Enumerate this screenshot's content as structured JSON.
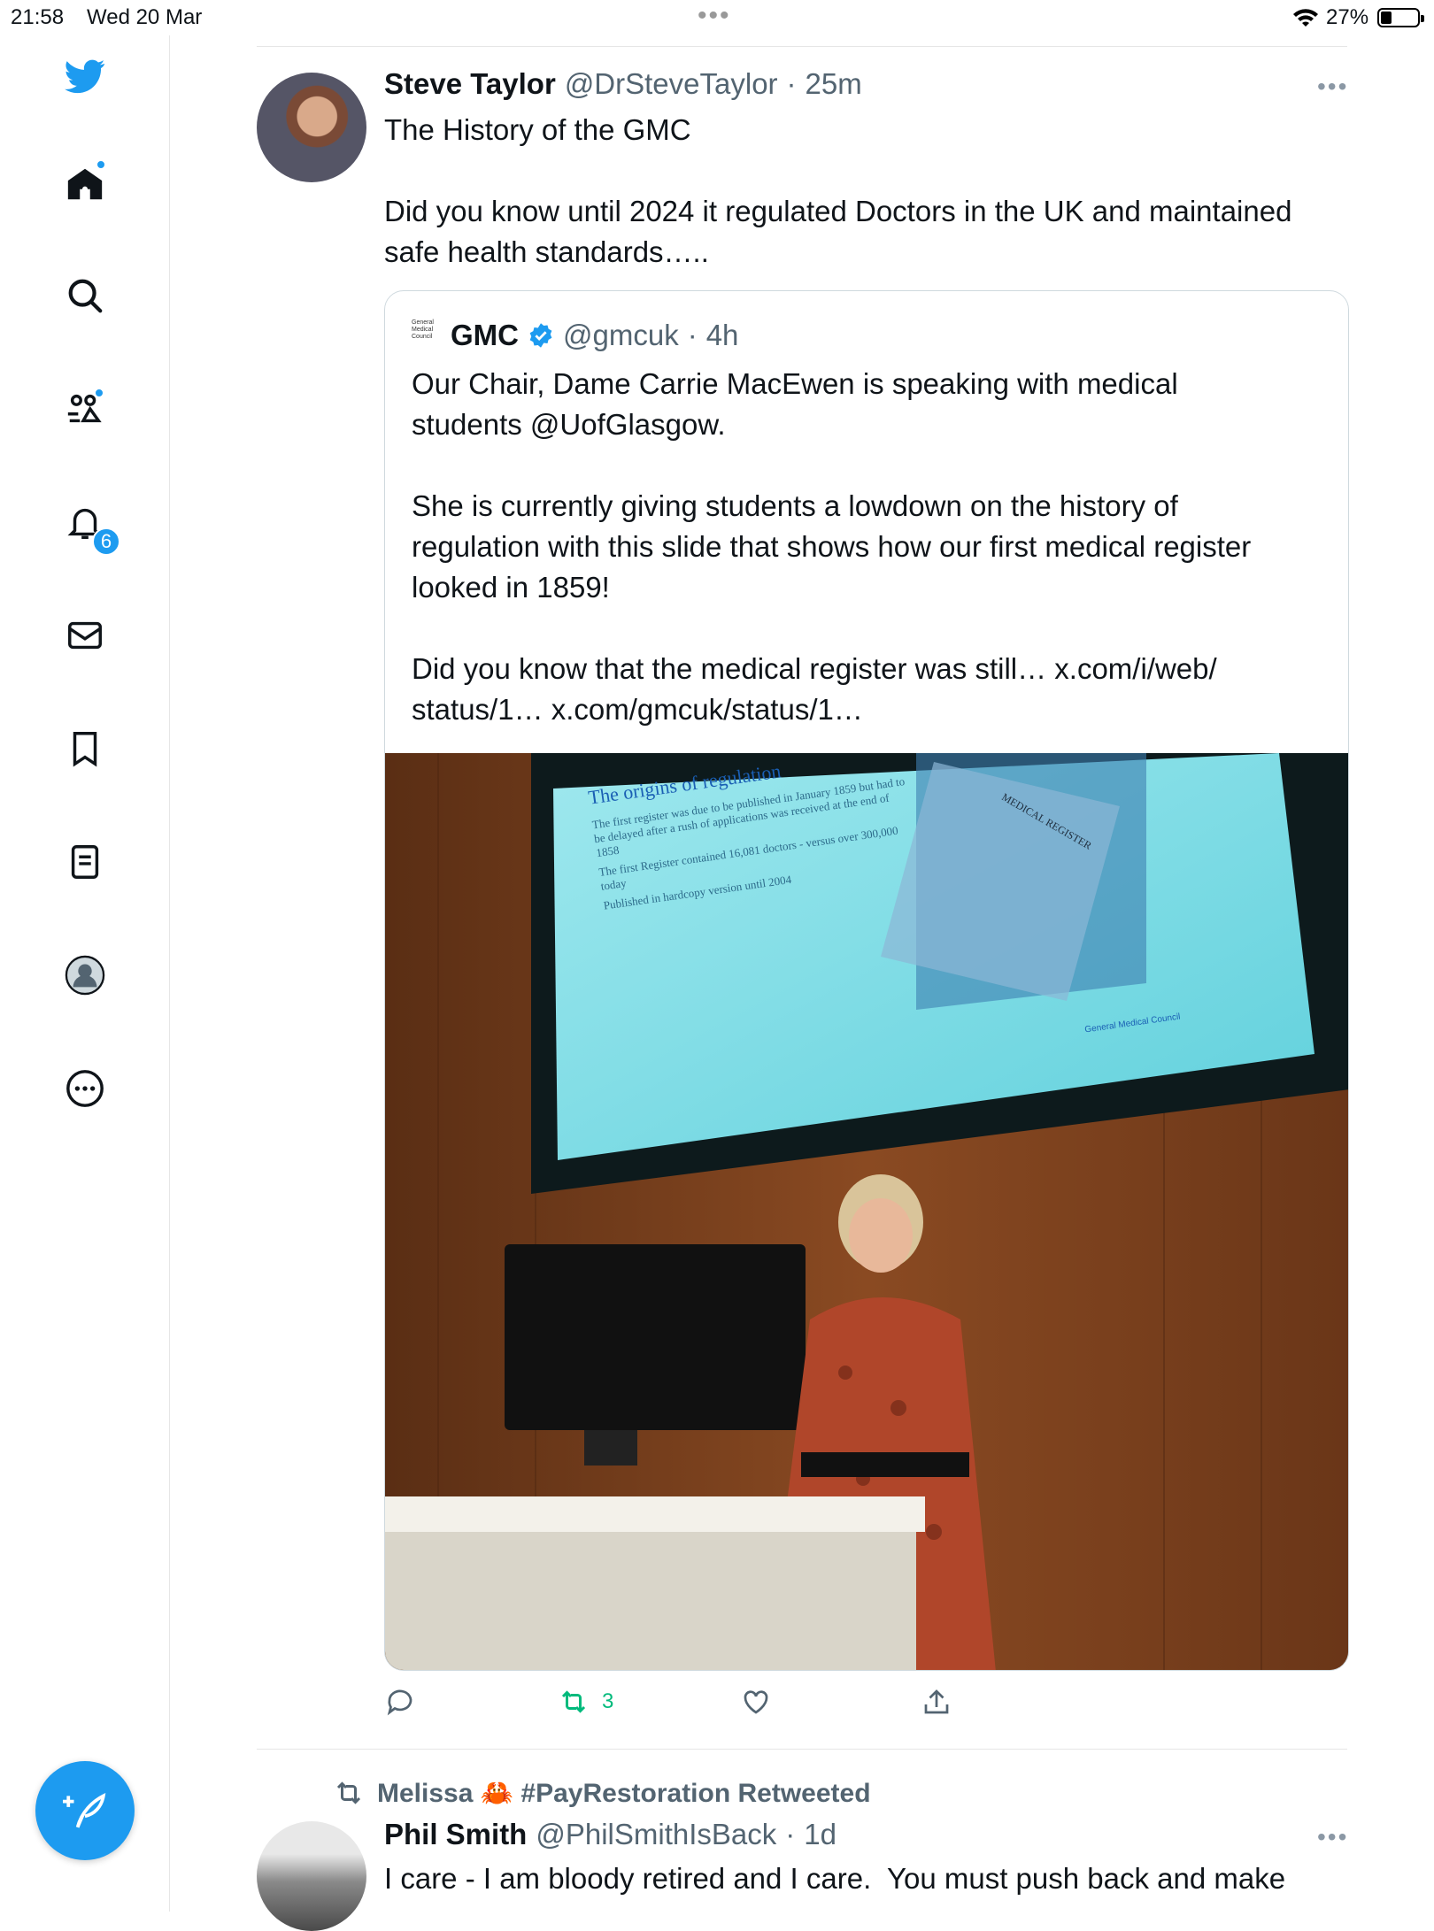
{
  "status_bar": {
    "time": "21:58",
    "date": "Wed 20 Mar",
    "battery": "27%"
  },
  "sidebar": {
    "items": [
      {
        "icon": "twitter-bird-icon"
      },
      {
        "icon": "home-icon"
      },
      {
        "icon": "search-icon"
      },
      {
        "icon": "communities-icon"
      },
      {
        "icon": "notifications-icon",
        "badge": "6"
      },
      {
        "icon": "messages-icon"
      },
      {
        "icon": "bookmarks-icon"
      },
      {
        "icon": "lists-icon"
      },
      {
        "icon": "profile-icon"
      },
      {
        "icon": "more-icon"
      }
    ],
    "accent": "#1d9bf0"
  },
  "tweet1": {
    "name": "Steve Taylor",
    "handle": "@DrSteveTaylor",
    "sep": "·",
    "time": "25m",
    "text": "The History of the GMC\n\nDid you know until 2024 it regulated Doctors in the UK and maintained\nsafe health standards…..",
    "quote": {
      "logo_text": "General\nMedical\nCouncil",
      "name": "GMC",
      "handle": "@gmcuk",
      "sep": "·",
      "time": "4h",
      "text": "Our Chair, Dame Carrie MacEwen is speaking with medical\nstudents @UofGlasgow.\n\nShe is currently giving students a lowdown on the history of\nregulation with this slide that shows how our first medical register\nlooked in 1859!\n\nDid you know that the medical register was still… x.com/i/web/\nstatus/1… x.com/gmcuk/status/1…",
      "photo": {
        "slide_title": "The origins of regulation",
        "slide_bullets": [
          "The first register was due to be published in January 1859 but had to be delayed after a rush of applications was received at the end of 1858",
          "The first Register contained 16,081 doctors - versus over 300,000 today",
          "Published in hardcopy version until 2004"
        ],
        "slide_book_title": "MEDICAL REGISTER",
        "slide_footer": "General Medical Council"
      }
    },
    "actions": {
      "reply": "",
      "retweet": "3",
      "like": "",
      "share": ""
    }
  },
  "tweet2": {
    "retweeted_by": "Melissa 🦀 #PayRestoration Retweeted",
    "name": "Phil Smith",
    "handle": "@PhilSmithIsBack",
    "sep": "·",
    "time": "1d",
    "text": "I care - I am bloody retired and I care.  You must push back and make"
  }
}
